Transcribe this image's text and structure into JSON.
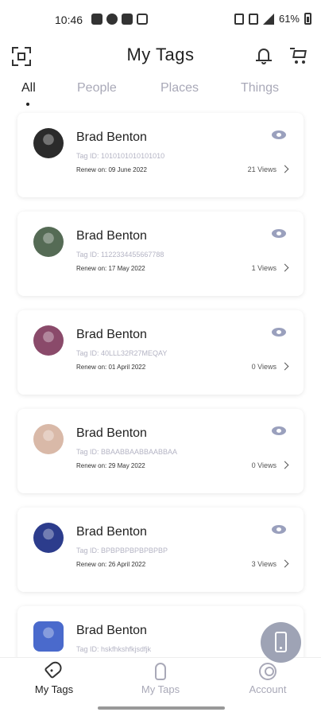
{
  "status_bar": {
    "time": "10:46",
    "battery": "61%"
  },
  "header": {
    "title": "My Tags"
  },
  "tabs": [
    {
      "label": "All",
      "active": true
    },
    {
      "label": "People",
      "active": false
    },
    {
      "label": "Places",
      "active": false
    },
    {
      "label": "Things",
      "active": false
    }
  ],
  "cards": [
    {
      "name": "Brad Benton",
      "tag_id": "Tag ID: 1010101010101010",
      "renew": "Renew on: 09 June 2022",
      "views": "21 Views",
      "avatar_color": "#2b2b2b"
    },
    {
      "name": "Brad Benton",
      "tag_id": "Tag ID: 1122334455667788",
      "renew": "Renew on: 17 May 2022",
      "views": "1 Views",
      "avatar_color": "#556b55"
    },
    {
      "name": "Brad Benton",
      "tag_id": "Tag ID: 40LLL32R27MEQAY",
      "renew": "Renew on: 01 April 2022",
      "views": "0 Views",
      "avatar_color": "#8a4a6a"
    },
    {
      "name": "Brad Benton",
      "tag_id": "Tag ID: BBAABBAABBAABBAA",
      "renew": "Renew on: 29 May 2022",
      "views": "0 Views",
      "avatar_color": "#d9b9a8"
    },
    {
      "name": "Brad Benton",
      "tag_id": "Tag ID: BPBPBPBPBPBPBP",
      "renew": "Renew on: 26 April 2022",
      "views": "3 Views",
      "avatar_color": "#2c3c8c"
    },
    {
      "name": "Brad Benton",
      "tag_id": "Tag ID: hskfhkshfkjsdfjk",
      "renew": "",
      "views": "",
      "avatar_color": "#4a6acc"
    }
  ],
  "bottom_nav": [
    {
      "label": "My Tags",
      "icon": "tag-icon",
      "active": true
    },
    {
      "label": "My Taps",
      "icon": "tap-icon",
      "active": false
    },
    {
      "label": "Account",
      "icon": "account-icon",
      "active": false
    }
  ]
}
